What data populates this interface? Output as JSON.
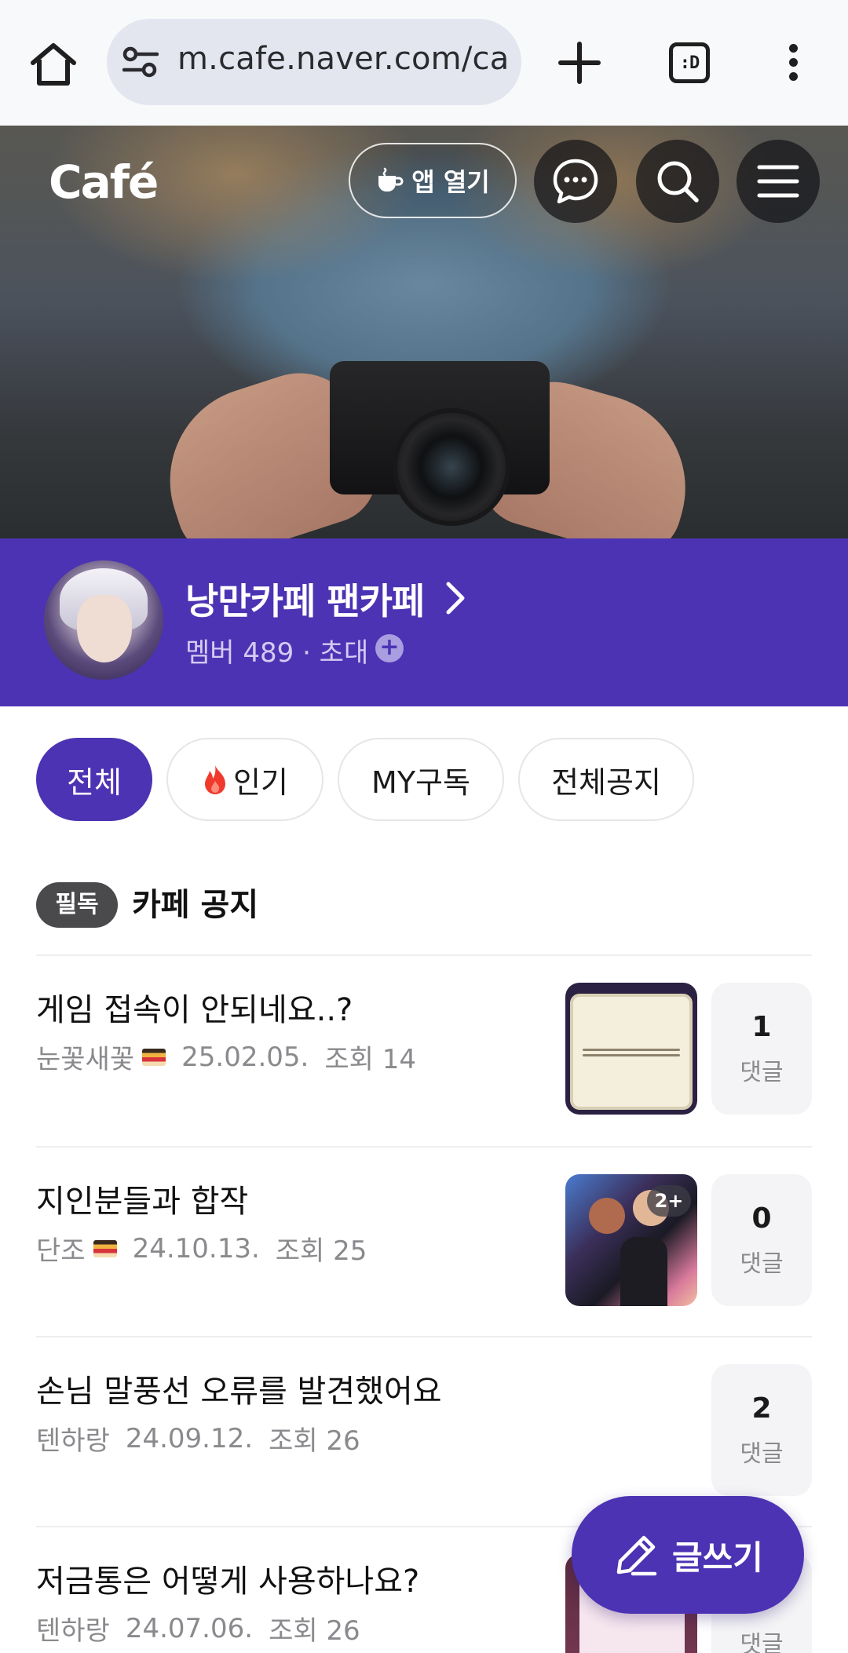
{
  "browser": {
    "url": "m.cafe.naver.com/ca",
    "tab_count_label": ":D"
  },
  "header": {
    "logo": "Café",
    "app_open_label": "앱 열기"
  },
  "cafe": {
    "name": "낭만카페 팬카페",
    "meta": "멤버 489 · 초대"
  },
  "filters": [
    {
      "label": "전체",
      "active": true
    },
    {
      "label": "인기",
      "active": false,
      "icon": "flame-icon"
    },
    {
      "label": "MY구독",
      "active": false
    },
    {
      "label": "전체공지",
      "active": false
    }
  ],
  "notice": {
    "badge": "필독",
    "title": "카페 공지"
  },
  "posts": [
    {
      "title": "게임 접속이 안되네요..?",
      "author": "눈꽃새꽃",
      "date": "25.02.05.",
      "views": "조회 14",
      "comments": "1",
      "comment_label": "댓글"
    },
    {
      "title": "지인분들과 합작",
      "author": "단조",
      "date": "24.10.13.",
      "views": "조회 25",
      "comments": "0",
      "comment_label": "댓글",
      "thumb_more": "2+"
    },
    {
      "title": "손님 말풍선 오류를 발견했어요",
      "author": "텐하랑",
      "date": "24.09.12.",
      "views": "조회 26",
      "comments": "2",
      "comment_label": "댓글"
    },
    {
      "title": "저금통은 어떻게 사용하나요?",
      "author": "텐하랑",
      "date": "24.07.06.",
      "views": "조회 26",
      "comment_label": "댓글"
    }
  ],
  "fab": {
    "label": "글쓰기"
  },
  "colors": {
    "brand": "#4c33b3",
    "browser_bar": "#f8f9fb",
    "url_pill": "#e3e6ee"
  }
}
